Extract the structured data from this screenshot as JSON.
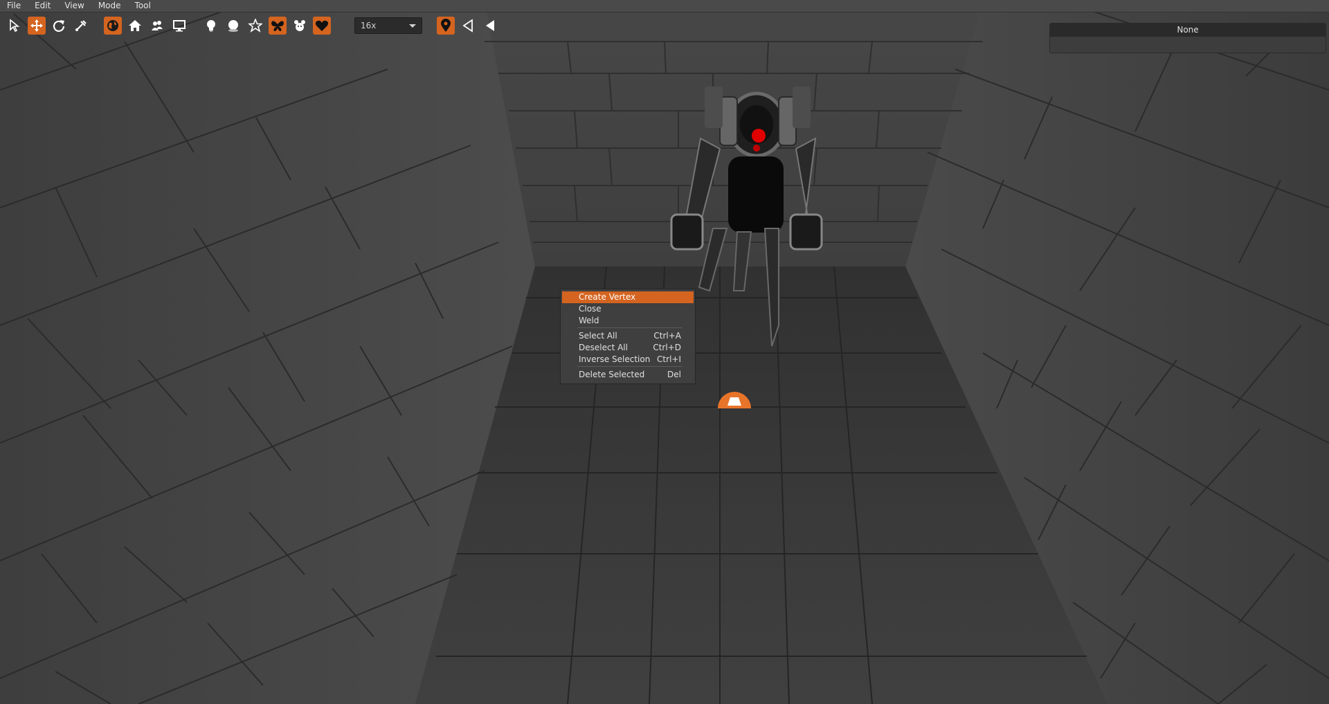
{
  "menubar": {
    "file": "File",
    "edit": "Edit",
    "view": "View",
    "mode": "Mode",
    "tool": "Tool"
  },
  "toolbar": {
    "tools": [
      {
        "icon": "pointer-icon",
        "active": false
      },
      {
        "icon": "move-icon",
        "active": true
      },
      {
        "icon": "rotate-icon",
        "active": false
      },
      {
        "icon": "vertex-tool-icon",
        "active": false
      },
      {
        "icon": "globe-icon",
        "active": true
      },
      {
        "icon": "home-icon",
        "active": false
      },
      {
        "icon": "people-icon",
        "active": false
      },
      {
        "icon": "monitor-icon",
        "active": false
      },
      {
        "icon": "lightbulb-icon",
        "active": false
      },
      {
        "icon": "sphere-icon",
        "active": false
      },
      {
        "icon": "star-icon",
        "active": false
      },
      {
        "icon": "butterfly-icon",
        "active": true
      },
      {
        "icon": "creature-icon",
        "active": false
      },
      {
        "icon": "heart-icon",
        "active": true
      },
      {
        "icon": "map-pin-icon",
        "active": true
      },
      {
        "icon": "triangle-outline-icon",
        "active": false
      },
      {
        "icon": "triangle-filled-icon",
        "active": false
      }
    ],
    "zoom_value": "16x"
  },
  "properties_panel": {
    "title": "None"
  },
  "context_menu": {
    "items": [
      {
        "label": "Create Vertex",
        "shortcut": "",
        "highlighted": true
      },
      {
        "label": "Close",
        "shortcut": ""
      },
      {
        "label": "Weld",
        "shortcut": ""
      },
      {
        "label": "Select All",
        "shortcut": "Ctrl+A"
      },
      {
        "label": "Deselect All",
        "shortcut": "Ctrl+D"
      },
      {
        "label": "Inverse Selection",
        "shortcut": "Ctrl+I"
      },
      {
        "label": "Delete Selected",
        "shortcut": "Del"
      }
    ]
  },
  "colors": {
    "accent": "#d4641f",
    "menubar_bg": "#4a4a4a",
    "wall": "#4a4a4a",
    "floor": "#3a3a3a",
    "robot_eye": "#e00000"
  }
}
